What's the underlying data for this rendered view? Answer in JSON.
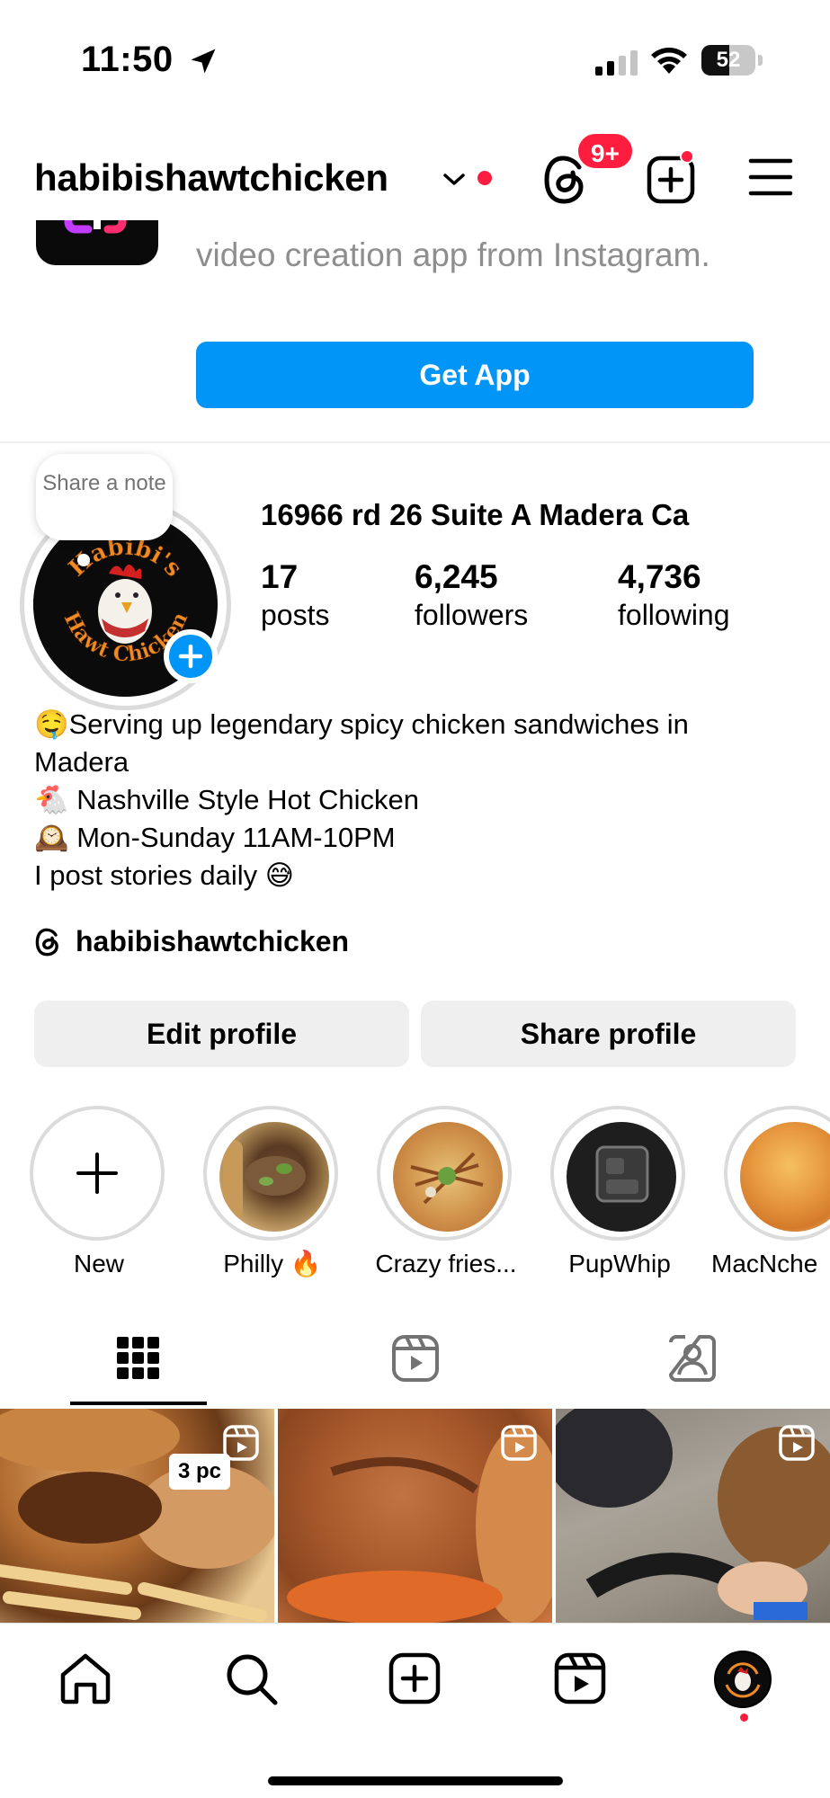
{
  "status_bar": {
    "time": "11:50",
    "battery": "52",
    "battery_level": 0.52
  },
  "header": {
    "username": "habibishawtchicken",
    "threads_badge": "9+"
  },
  "promo": {
    "text": "video creation app from Instagram.",
    "button": "Get App"
  },
  "profile": {
    "note_prompt": "Share a note",
    "name": "16966 rd 26 Suite A Madera Ca",
    "stats": [
      {
        "value": "17",
        "label": "posts"
      },
      {
        "value": "6,245",
        "label": "followers"
      },
      {
        "value": "4,736",
        "label": "following"
      }
    ],
    "bio": [
      "🤤Serving up legendary spicy chicken sandwiches in",
      "Madera",
      "🐔 Nashville Style Hot Chicken",
      "🕰️ Mon-Sunday 11AM-10PM",
      "I post stories daily 😅"
    ],
    "threads_handle": "habibishawtchicken",
    "avatar_text": "Habibi's Hawt Chicken"
  },
  "actions": {
    "edit": "Edit profile",
    "share": "Share profile"
  },
  "highlights": [
    {
      "label": "New"
    },
    {
      "label": "Philly 🔥"
    },
    {
      "label": "Crazy fries..."
    },
    {
      "label": "PupWhip"
    },
    {
      "label": "MacNche"
    }
  ],
  "grid": [
    {
      "badge": "3 pc"
    }
  ],
  "colors": {
    "accent": "#0095f6",
    "notification": "#ff1d3f"
  }
}
